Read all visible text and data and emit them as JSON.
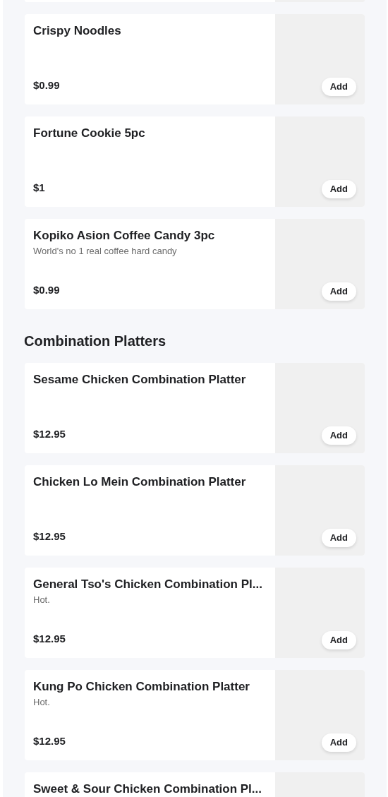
{
  "sections": [
    {
      "items": [
        {
          "name": "Crispy Noodles",
          "price": "$0.99",
          "button": "Add"
        },
        {
          "name": "Fortune Cookie 5pc",
          "price": "$1",
          "button": "Add"
        },
        {
          "name": "Kopiko Asion Coffee Candy 3pc",
          "description": "World's no 1 real coffee hard candy",
          "price": "$0.99",
          "button": "Add"
        }
      ]
    },
    {
      "title": "Combination Platters",
      "items": [
        {
          "name": "Sesame Chicken Combination Platter",
          "price": "$12.95",
          "button": "Add"
        },
        {
          "name": "Chicken Lo Mein Combination Platter",
          "price": "$12.95",
          "button": "Add"
        },
        {
          "name": "General Tso's Chicken Combination Pl...",
          "description": "Hot.",
          "price": "$12.95",
          "button": "Add"
        },
        {
          "name": "Kung Po Chicken Combination Platter",
          "description": "Hot.",
          "price": "$12.95",
          "button": "Add"
        },
        {
          "name": "Sweet & Sour Chicken Combination Pl..."
        }
      ]
    }
  ]
}
